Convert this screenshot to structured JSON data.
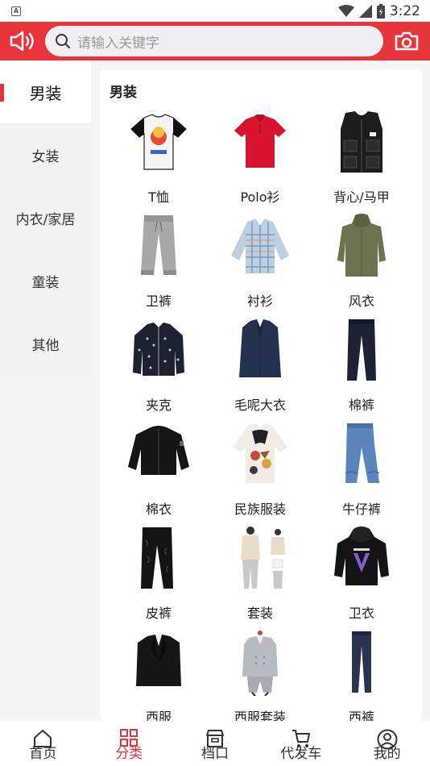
{
  "status": {
    "time": "3:22",
    "left_icon": "A"
  },
  "header": {
    "search_placeholder": "请输入关键字"
  },
  "sidebar": {
    "items": [
      {
        "label": "男装"
      },
      {
        "label": "女装"
      },
      {
        "label": "内衣/家居"
      },
      {
        "label": "童装"
      },
      {
        "label": "其他"
      }
    ]
  },
  "panel": {
    "title": "男装",
    "items": [
      {
        "label": "T恤",
        "icon": "tshirt-image"
      },
      {
        "label": "Polo衫",
        "icon": "polo-image"
      },
      {
        "label": "背心/马甲",
        "icon": "vest-image"
      },
      {
        "label": "卫裤",
        "icon": "sweatpants-image"
      },
      {
        "label": "衬衫",
        "icon": "shirt-image"
      },
      {
        "label": "风衣",
        "icon": "trenchcoat-image"
      },
      {
        "label": "夹克",
        "icon": "jacket-image"
      },
      {
        "label": "毛呢大衣",
        "icon": "wool-coat-image"
      },
      {
        "label": "棉裤",
        "icon": "cotton-pants-image"
      },
      {
        "label": "棉衣",
        "icon": "padded-jacket-image"
      },
      {
        "label": "民族服装",
        "icon": "ethnic-wear-image"
      },
      {
        "label": "牛仔裤",
        "icon": "jeans-image"
      },
      {
        "label": "皮裤",
        "icon": "leather-pants-image"
      },
      {
        "label": "套装",
        "icon": "outfit-set-image"
      },
      {
        "label": "卫衣",
        "icon": "hoodie-image"
      },
      {
        "label": "西服",
        "icon": "blazer-image"
      },
      {
        "label": "西服套装",
        "icon": "suit-set-image"
      },
      {
        "label": "西裤",
        "icon": "trousers-image"
      }
    ]
  },
  "nav": {
    "items": [
      {
        "label": "首页"
      },
      {
        "label": "分类"
      },
      {
        "label": "档口"
      },
      {
        "label": "代发车"
      },
      {
        "label": "我的"
      }
    ]
  },
  "colors": {
    "accent": "#e8353b",
    "bg": "#f5f5f5"
  }
}
